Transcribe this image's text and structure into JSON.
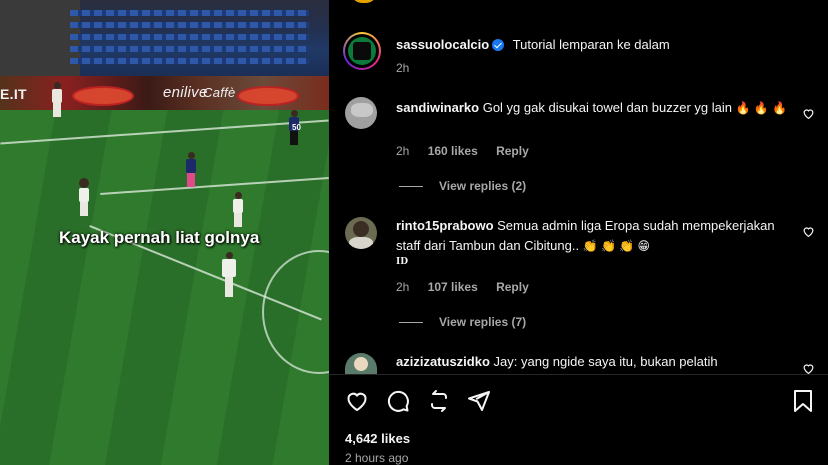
{
  "video": {
    "ad_left": "E.IT",
    "ad_mid": "enilive",
    "ad_script": "Caffè",
    "caption_overlay": "Kayak pernah liat golnya",
    "player_number": "50"
  },
  "post": {
    "author": "sassuolocalcio",
    "caption": "Tutorial lemparan ke dalam",
    "time": "2h"
  },
  "comments": [
    {
      "username": "sandiwinarko",
      "text": "Gol yg gak disukai towel dan buzzer yg lain",
      "emoji": "🔥 🔥 🔥",
      "time": "2h",
      "likes": "160 likes",
      "reply": "Reply",
      "view_replies": "View replies (2)"
    },
    {
      "username": "rinto15prabowo",
      "text": "Semua admin liga Eropa sudah mempekerjakan staff dari Tambun dan Cibitung..",
      "emoji": "👏 👏 👏 😁",
      "badge": "ID",
      "time": "2h",
      "likes": "107 likes",
      "reply": "Reply",
      "view_replies": "View replies (7)"
    },
    {
      "username": "azizizatuszidko",
      "text": "Jay: yang ngide saya itu, bukan pelatih"
    }
  ],
  "footer": {
    "likes": "4,642 likes",
    "ago": "2 hours ago"
  },
  "colors": {
    "background": "#000000",
    "text": "#f5f5f5",
    "muted": "#a8a8a8",
    "verified": "#1877f2",
    "sassuolo_green": "#0b7a3b"
  },
  "icons": [
    "heart-icon",
    "comment-icon",
    "share-icon",
    "send-icon",
    "bookmark-icon",
    "verified-icon"
  ]
}
